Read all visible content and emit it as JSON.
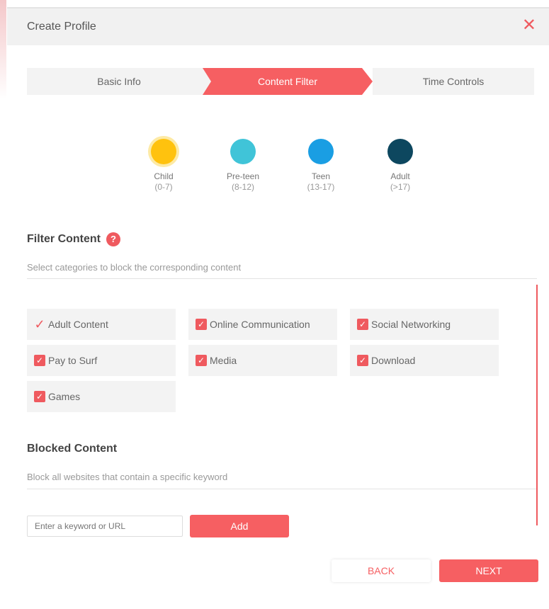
{
  "dialog": {
    "title": "Create Profile",
    "close_glyph": "✕"
  },
  "steps": [
    "Basic Info",
    "Content Filter",
    "Time Controls"
  ],
  "levels": [
    {
      "name": "Child",
      "range": "(0-7)",
      "color": "#ffc20e",
      "selected": true
    },
    {
      "name": "Pre-teen",
      "range": "(8-12)",
      "color": "#40c4d8",
      "selected": false
    },
    {
      "name": "Teen",
      "range": "(13-17)",
      "color": "#1a9ee3",
      "selected": false
    },
    {
      "name": "Adult",
      "range": "(>17)",
      "color": "#0d475f",
      "selected": false
    }
  ],
  "filter": {
    "title": "Filter Content",
    "help_glyph": "?",
    "description": "Select categories to block the corresponding content",
    "categories": [
      {
        "label": "Adult Content",
        "checked": true,
        "style": "plain"
      },
      {
        "label": "Online Communication",
        "checked": true,
        "style": "box"
      },
      {
        "label": "Social Networking",
        "checked": true,
        "style": "box"
      },
      {
        "label": "Pay to Surf",
        "checked": true,
        "style": "box"
      },
      {
        "label": "Media",
        "checked": true,
        "style": "box"
      },
      {
        "label": "Download",
        "checked": true,
        "style": "box"
      },
      {
        "label": "Games",
        "checked": true,
        "style": "box"
      }
    ]
  },
  "blocked": {
    "title": "Blocked Content",
    "description": "Block all websites that contain a specific keyword",
    "input_placeholder": "Enter a keyword or URL",
    "add_label": "Add"
  },
  "footer": {
    "back_label": "BACK",
    "next_label": "NEXT"
  },
  "colors": {
    "accent": "#f65f62"
  }
}
